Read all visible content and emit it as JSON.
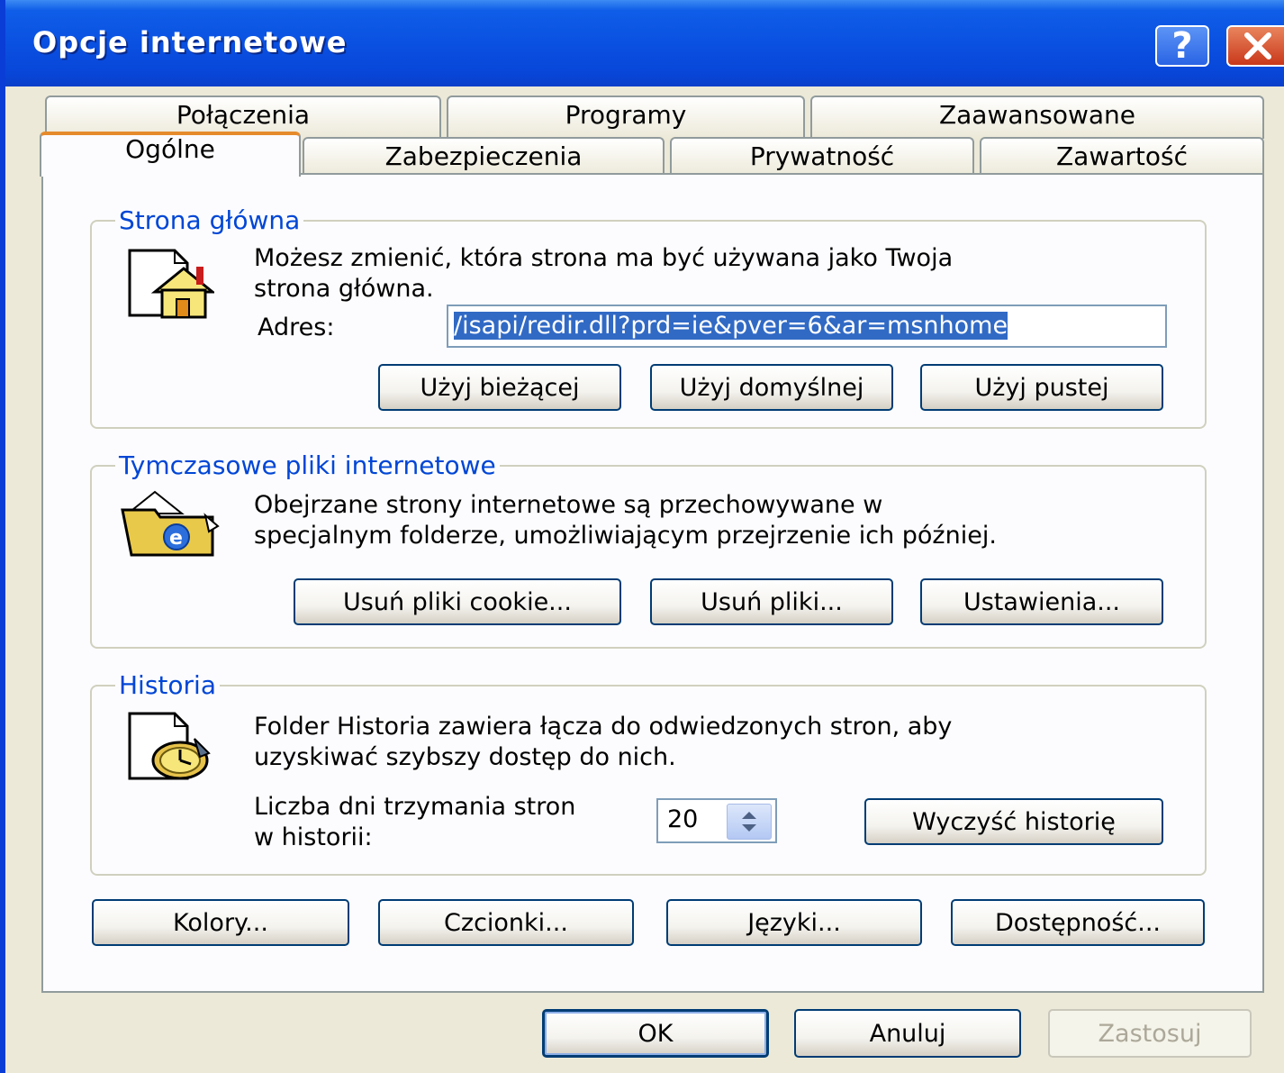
{
  "window": {
    "title": "Opcje internetowe",
    "help_label": "?",
    "accent_color": "#0a4fe0"
  },
  "tabs_back": [
    {
      "label": "Połączenia"
    },
    {
      "label": "Programy"
    },
    {
      "label": "Zaawansowane"
    }
  ],
  "tabs_front": [
    {
      "label": "Ogólne",
      "active": true
    },
    {
      "label": "Zabezpieczenia"
    },
    {
      "label": "Prywatność"
    },
    {
      "label": "Zawartość"
    }
  ],
  "home": {
    "title": "Strona główna",
    "desc_line1": "Możesz zmienić, która strona ma być używana jako Twoja",
    "desc_line2": "strona główna.",
    "address_label": "Adres:",
    "address_value": "/isapi/redir.dll?prd=ie&pver=6&ar=msnhome",
    "btn_current": "Użyj bieżącej",
    "btn_default": "Użyj domyślnej",
    "btn_blank": "Użyj pustej"
  },
  "temp": {
    "title": "Tymczasowe pliki internetowe",
    "desc_line1": "Obejrzane strony internetowe są przechowywane w",
    "desc_line2": "specjalnym folderze, umożliwiającym przejrzenie ich później.",
    "btn_cookies": "Usuń pliki cookie...",
    "btn_files": "Usuń pliki...",
    "btn_settings": "Ustawienia..."
  },
  "history": {
    "title": "Historia",
    "desc_line1": "Folder Historia zawiera łącza do odwiedzonych stron, aby",
    "desc_line2": "uzyskiwać szybszy dostęp do nich.",
    "days_label_line1": "Liczba dni trzymania stron",
    "days_label_line2": "w historii:",
    "days_value": "20",
    "btn_clear": "Wyczyść historię"
  },
  "bottom_row": {
    "colors": "Kolory...",
    "fonts": "Czcionki...",
    "languages": "Języki...",
    "accessibility": "Dostępność..."
  },
  "dialog_buttons": {
    "ok": "OK",
    "cancel": "Anuluj",
    "apply": "Zastosuj"
  }
}
